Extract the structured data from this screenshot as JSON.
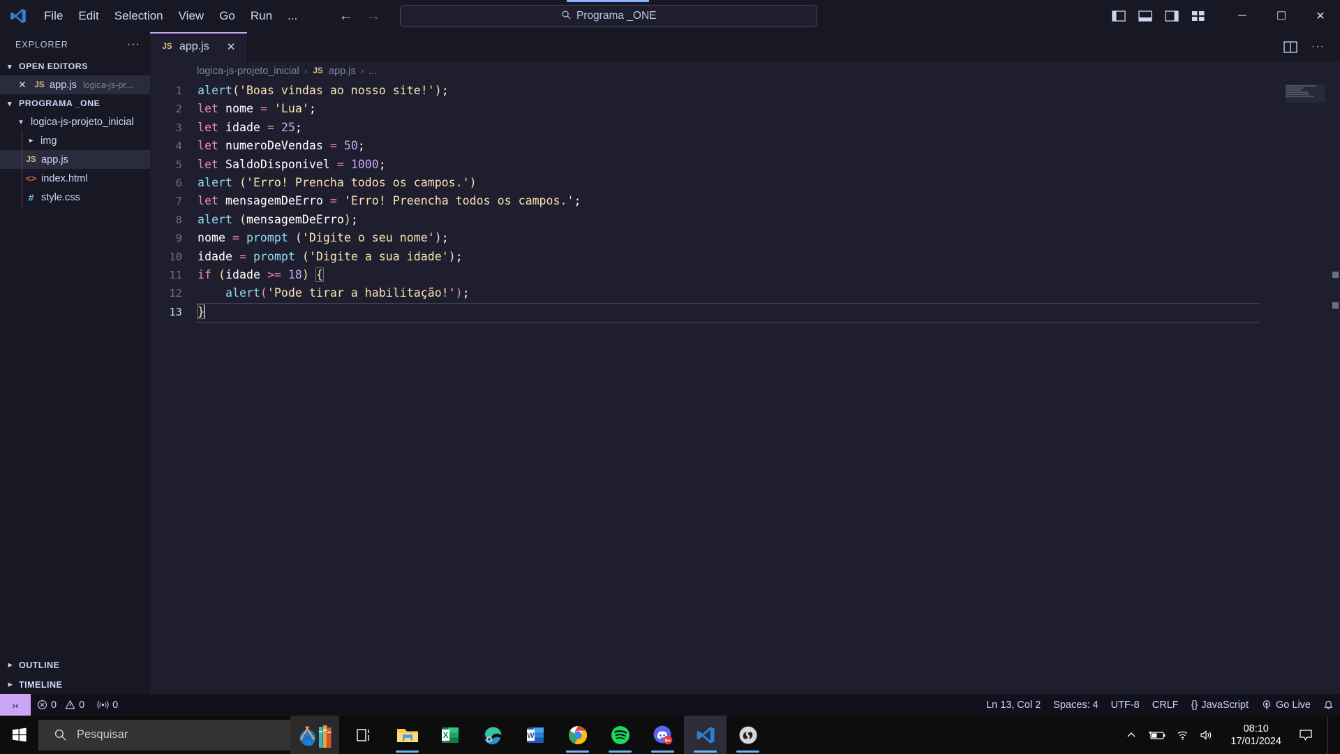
{
  "titlebar": {
    "logo_icon": "vscode-logo-icon",
    "menus": [
      "File",
      "Edit",
      "Selection",
      "View",
      "Go",
      "Run",
      "..."
    ],
    "back_icon": "arrow-left-icon",
    "forward_icon": "arrow-right-icon",
    "command_center": {
      "icon": "search-icon",
      "text": "Programa _ONE"
    },
    "layout_icons": [
      "toggle-primary-sidebar-icon",
      "toggle-panel-icon",
      "toggle-secondary-sidebar-icon",
      "customize-layout-icon"
    ],
    "window_controls": {
      "minimize": "─",
      "maximize": "☐",
      "close": "✕"
    }
  },
  "sidebar": {
    "title": "EXPLORER",
    "more_actions": "···",
    "open_editors": {
      "label": "OPEN EDITORS",
      "items": [
        {
          "close": "✕",
          "icon": "js-file-icon",
          "icon_text": "JS",
          "name": "app.js",
          "path": "logica-js-pr..."
        }
      ]
    },
    "folder": {
      "label": "PROGRAMA _ONE",
      "root": "logica-js-projeto_inicial",
      "items": [
        {
          "name": "img",
          "type": "folder",
          "icon": "chevron-right-icon"
        },
        {
          "name": "app.js",
          "type": "js",
          "icon_text": "JS"
        },
        {
          "name": "index.html",
          "type": "html",
          "icon_text": "<>"
        },
        {
          "name": "style.css",
          "type": "css",
          "icon_text": "#"
        }
      ]
    },
    "outline_label": "OUTLINE",
    "timeline_label": "TIMELINE"
  },
  "editor": {
    "tab": {
      "icon_text": "JS",
      "label": "app.js",
      "close": "✕"
    },
    "actions": [
      "split-editor-icon",
      "more-actions-icon"
    ],
    "breadcrumb": [
      "logica-js-projeto_inicial",
      "app.js",
      "..."
    ],
    "breadcrumb_file_icon": "JS",
    "lines": [
      {
        "n": 1,
        "tokens": [
          [
            "t-fn",
            "alert"
          ],
          [
            "t-par1",
            "("
          ],
          [
            "t-str",
            "'Boas vindas ao nosso site!'"
          ],
          [
            "t-par1",
            ")"
          ],
          [
            "t-pun",
            ";"
          ]
        ]
      },
      {
        "n": 2,
        "tokens": [
          [
            "t-kw",
            "let"
          ],
          [
            "t-var",
            " nome "
          ],
          [
            "t-op",
            "="
          ],
          [
            "t-str",
            " 'Lua'"
          ],
          [
            "t-pun",
            ";"
          ]
        ]
      },
      {
        "n": 3,
        "tokens": [
          [
            "t-kw",
            "let"
          ],
          [
            "t-var",
            " idade "
          ],
          [
            "t-op",
            "="
          ],
          [
            "t-num",
            " 25"
          ],
          [
            "t-pun",
            ";"
          ]
        ]
      },
      {
        "n": 4,
        "tokens": [
          [
            "t-kw",
            "let"
          ],
          [
            "t-var",
            " numeroDeVendas "
          ],
          [
            "t-op",
            "="
          ],
          [
            "t-num",
            " 50"
          ],
          [
            "t-pun",
            ";"
          ]
        ]
      },
      {
        "n": 5,
        "tokens": [
          [
            "t-kw",
            "let"
          ],
          [
            "t-var",
            " SaldoDisponivel "
          ],
          [
            "t-op",
            "="
          ],
          [
            "t-num",
            " 1000"
          ],
          [
            "t-pun",
            ";"
          ]
        ]
      },
      {
        "n": 6,
        "tokens": [
          [
            "t-fn",
            "alert"
          ],
          [
            "t-var",
            " "
          ],
          [
            "t-par1",
            "("
          ],
          [
            "t-str",
            "'Erro! Prencha todos os campos.'"
          ],
          [
            "t-par1",
            ")"
          ]
        ]
      },
      {
        "n": 7,
        "tokens": [
          [
            "t-kw",
            "let"
          ],
          [
            "t-var",
            " mensagemDeErro "
          ],
          [
            "t-op",
            "="
          ],
          [
            "t-str",
            " 'Erro! Preencha todos os campos.'"
          ],
          [
            "t-pun",
            ";"
          ]
        ]
      },
      {
        "n": 8,
        "tokens": [
          [
            "t-fn",
            "alert"
          ],
          [
            "t-var",
            " "
          ],
          [
            "t-par1",
            "("
          ],
          [
            "t-var",
            "mensagemDeErro"
          ],
          [
            "t-par1",
            ")"
          ],
          [
            "t-pun",
            ";"
          ]
        ]
      },
      {
        "n": 9,
        "tokens": [
          [
            "t-var",
            "nome "
          ],
          [
            "t-op",
            "="
          ],
          [
            "t-fn",
            " prompt"
          ],
          [
            "t-var",
            " "
          ],
          [
            "t-par1",
            "("
          ],
          [
            "t-str",
            "'Digite o seu nome'"
          ],
          [
            "t-par1",
            ")"
          ],
          [
            "t-pun",
            ";"
          ]
        ]
      },
      {
        "n": 10,
        "tokens": [
          [
            "t-var",
            "idade "
          ],
          [
            "t-op",
            "="
          ],
          [
            "t-fn",
            " prompt"
          ],
          [
            "t-var",
            " "
          ],
          [
            "t-par1",
            "("
          ],
          [
            "t-str",
            "'Digite a sua idade'"
          ],
          [
            "t-par1",
            ")"
          ],
          [
            "t-pun",
            ";"
          ]
        ]
      },
      {
        "n": 11,
        "tokens": [
          [
            "t-kw",
            "if"
          ],
          [
            "t-var",
            " "
          ],
          [
            "t-par1",
            "("
          ],
          [
            "t-var",
            "idade "
          ],
          [
            "t-op",
            ">="
          ],
          [
            "t-num",
            " 18"
          ],
          [
            "t-par1",
            ")"
          ],
          [
            "t-var",
            " "
          ],
          [
            "brk t-par1",
            "{"
          ]
        ]
      },
      {
        "n": 12,
        "tokens": [
          [
            "t-var",
            "    "
          ],
          [
            "t-fn",
            "alert"
          ],
          [
            "t-par2",
            "("
          ],
          [
            "t-str",
            "'Pode tirar a habilitação!'"
          ],
          [
            "t-par2",
            ")"
          ],
          [
            "t-pun",
            ";"
          ]
        ]
      },
      {
        "n": 13,
        "tokens": [
          [
            "brk t-par1",
            "}"
          ]
        ],
        "current": true
      }
    ]
  },
  "statusbar": {
    "remote_icon": "remote-window-icon",
    "left": [
      {
        "icon": "error-icon",
        "value": "0"
      },
      {
        "icon": "warning-icon",
        "value": "0"
      },
      {
        "icon": "ports-icon",
        "value": "0"
      }
    ],
    "cursor_position": "Ln 13, Col 2",
    "indentation": "Spaces: 4",
    "encoding": "UTF-8",
    "eol": "CRLF",
    "language_icon": "{}",
    "language": "JavaScript",
    "go_live_icon": "broadcast-icon",
    "go_live": "Go Live",
    "bell_icon": "bell-icon"
  },
  "taskbar": {
    "start_icon": "windows-start-icon",
    "search_icon": "search-icon",
    "search_placeholder": "Pesquisar",
    "widget_icon": "weather-widget-icon",
    "apps": [
      {
        "name": "task-view-icon",
        "open": false,
        "focus": false
      },
      {
        "name": "file-explorer-icon",
        "open": true,
        "focus": false
      },
      {
        "name": "excel-icon",
        "open": false,
        "focus": false
      },
      {
        "name": "edge-icon",
        "open": false,
        "focus": false
      },
      {
        "name": "word-icon",
        "open": false,
        "focus": false
      },
      {
        "name": "chrome-icon",
        "open": true,
        "focus": false
      },
      {
        "name": "spotify-icon",
        "open": true,
        "focus": false
      },
      {
        "name": "discord-icon",
        "open": true,
        "focus": false,
        "badge": "9+"
      },
      {
        "name": "vscode-icon",
        "open": true,
        "focus": true
      },
      {
        "name": "obs-icon",
        "open": true,
        "focus": false
      }
    ],
    "tray": [
      "chevron-up-icon",
      "battery-charging-icon",
      "wifi-icon",
      "volume-icon"
    ],
    "clock_time": "08:10",
    "clock_date": "17/01/2024",
    "notification_icon": "notification-icon"
  },
  "colors": {
    "accent": "#89b4fa",
    "tab_accent": "#cba6f7",
    "editor_bg": "#1e1e2e",
    "sidebar_bg": "#181825",
    "statusbar_bg": "#11111b"
  }
}
